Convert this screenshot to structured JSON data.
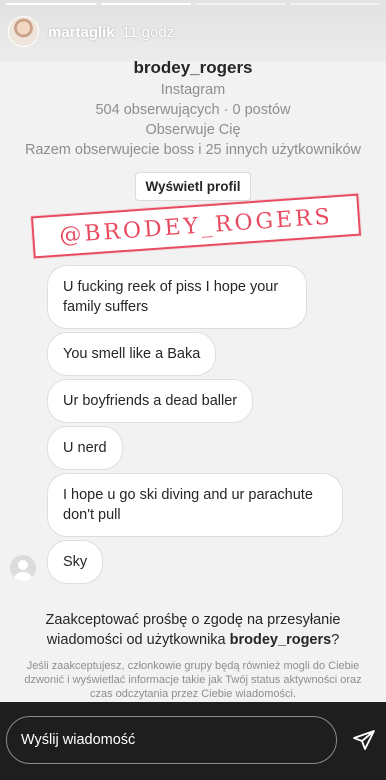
{
  "story": {
    "username": "martaglik",
    "time": "11 godz."
  },
  "profile": {
    "username": "brodey_rogers",
    "platform": "Instagram",
    "stats": "504 obserwujących · 0 postów",
    "follows_you": "Obserwuje Cię",
    "mutual": "Razem obserwujecie boss i 25 innych użytkowników",
    "view_profile_label": "Wyświetl profil"
  },
  "sticker": {
    "text": "@BRODEY_ROGERS",
    "color": "#e84b5f"
  },
  "messages": [
    "U fucking reek of piss I hope your family suffers",
    "You smell like a Baka",
    "Ur boyfriends a dead baller",
    "U nerd",
    "I hope u go ski diving and ur parachute don't pull",
    "Sky"
  ],
  "request": {
    "question_prefix": "Zaakceptować prośbę o zgodę na przesyłanie wiadomości od użytkownika",
    "question_user": "brodey_rogers",
    "question_suffix": "?",
    "info": "Jeśli zaakceptujesz, członkowie grupy będą również mogli do Ciebie dzwonić i wyświetlać informacje takie jak Twój status aktywności oraz czas odczytania przez Ciebie wiadomości."
  },
  "reply": {
    "placeholder": "Wyślij wiadomość"
  },
  "icons": {
    "send": "send-icon",
    "avatar": "avatar"
  }
}
